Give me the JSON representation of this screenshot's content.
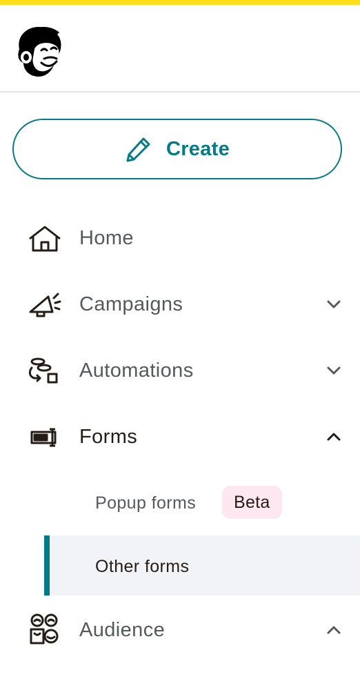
{
  "brand": {
    "accent": "#ffe01b",
    "primary": "#007c89"
  },
  "logo": {
    "name": "mailchimp-freddie-logo"
  },
  "create_button": {
    "label": "Create",
    "icon": "pencil-icon"
  },
  "nav": {
    "items": [
      {
        "label": "Home",
        "icon": "home-icon",
        "state": "none"
      },
      {
        "label": "Campaigns",
        "icon": "megaphone-icon",
        "state": "collapsed"
      },
      {
        "label": "Automations",
        "icon": "automation-flow-icon",
        "state": "collapsed"
      },
      {
        "label": "Forms",
        "icon": "form-icon",
        "state": "expanded"
      },
      {
        "label": "Audience",
        "icon": "audience-icon",
        "state": "expanded"
      }
    ],
    "forms_subitems": [
      {
        "label": "Popup forms",
        "badge": "Beta"
      },
      {
        "label": "Other forms",
        "active": true
      }
    ]
  }
}
